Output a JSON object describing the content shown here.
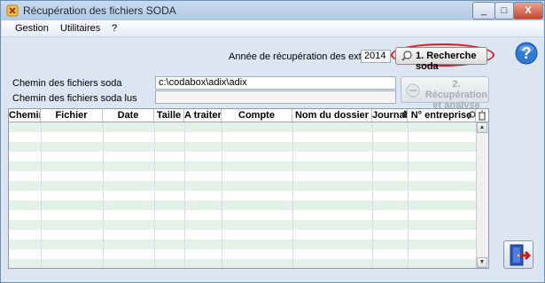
{
  "window": {
    "title": "Récupération des fichiers SODA",
    "controls": [
      "_",
      "□",
      "X"
    ]
  },
  "menu": [
    {
      "label": "Gestion"
    },
    {
      "label": "Utilitaires"
    },
    {
      "label": "?"
    }
  ],
  "form": {
    "year_label": "Année de récupération des extraits",
    "year_value": "2014",
    "search_button_label": "1. Recherche soda",
    "path_label": "Chemin des fichiers soda",
    "path_value": "c:\\codabox\\adix\\adix",
    "read_path_label": "Chemin des fichiers soda lus",
    "read_path_value": "",
    "recup_button_line1": "2. Récupération",
    "recup_button_line2": "et analyse"
  },
  "table": {
    "columns": [
      "Chemin",
      "Fichier",
      "Date",
      "Taille",
      "A traiter",
      "Compte",
      "Nom du dossier",
      "Journal",
      "N° entreprise"
    ],
    "rows": []
  },
  "colors": {
    "title_bar": "#b3c9e3",
    "window_bg": "#dbe6f2",
    "row_alt": "#e3f1e8",
    "highlight_ring": "#d81e1e"
  }
}
